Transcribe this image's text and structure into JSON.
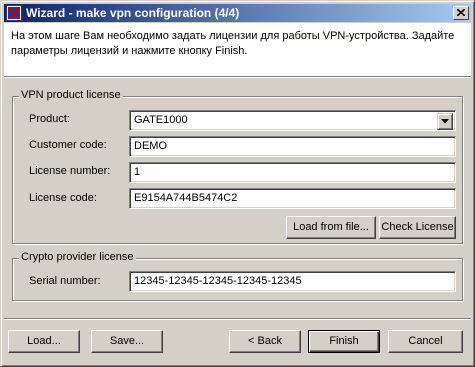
{
  "window": {
    "title": "Wizard - make vpn configuration (4/4)",
    "app_icon": "app-logo-icon",
    "close_icon": "close-icon"
  },
  "header": {
    "instruction": "На этом шаге Вам необходимо задать лицензии для работы VPN-устройства. Задайте параметры лицензий и нажмите кнопку Finish."
  },
  "vpn_license": {
    "group_title": "VPN product license",
    "product_label": "Product:",
    "product_value": "GATE1000",
    "customer_code_label": "Customer code:",
    "customer_code_value": "DEMO",
    "license_number_label": "License number:",
    "license_number_value": "1",
    "license_code_label": "License code:",
    "license_code_value": "E9154A744B5474C2",
    "load_from_file_label": "Load from file...",
    "check_license_label": "Check License"
  },
  "crypto_license": {
    "group_title": "Crypto provider license",
    "serial_label": "Serial number:",
    "serial_value": "12345-12345-12345-12345-12345"
  },
  "footer": {
    "load_label": "Load...",
    "save_label": "Save...",
    "back_label": "< Back",
    "finish_label": "Finish",
    "cancel_label": "Cancel"
  }
}
